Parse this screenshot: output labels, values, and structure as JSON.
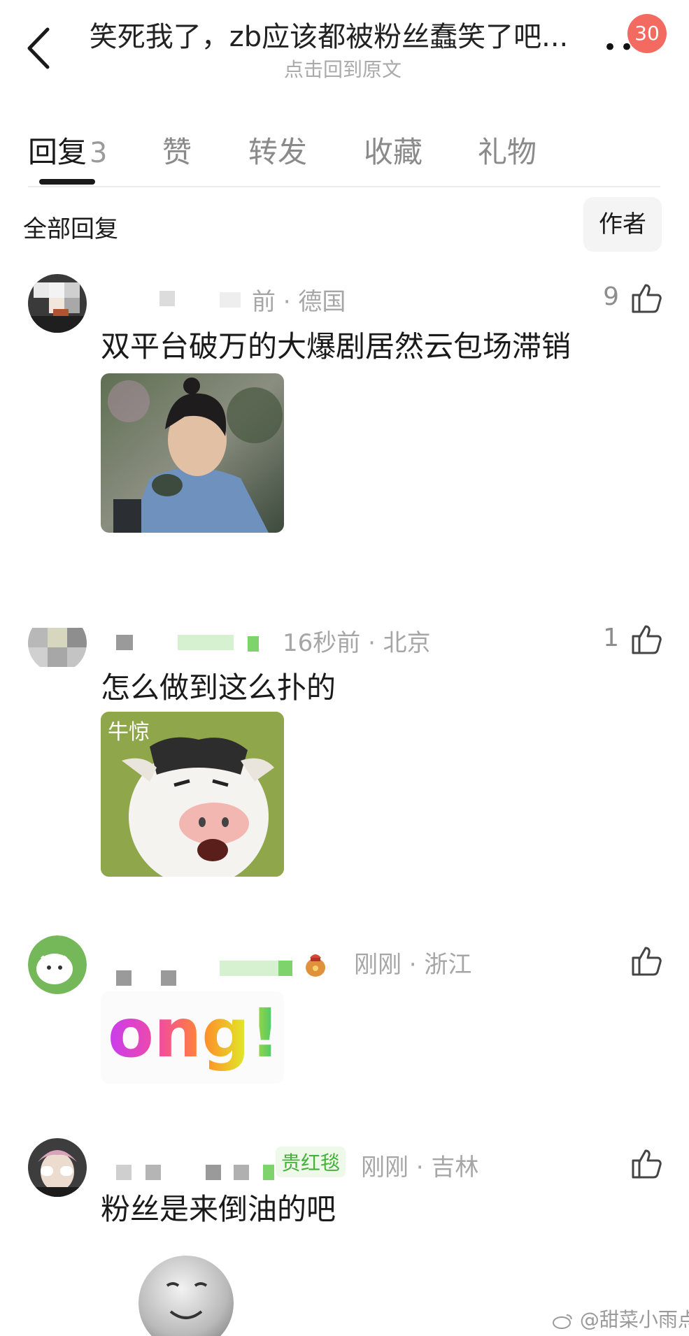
{
  "header": {
    "title": "笑死我了，zb应该都被粉丝蠢笑了吧...",
    "subtitle": "点击回到原文",
    "badge": "30",
    "more_label": "••"
  },
  "tabs": [
    {
      "label": "回复",
      "count": "3"
    },
    {
      "label": "赞"
    },
    {
      "label": "转发"
    },
    {
      "label": "收藏"
    },
    {
      "label": "礼物"
    }
  ],
  "filter": {
    "all_label": "全部回复",
    "author_label": "作者"
  },
  "comments": [
    {
      "meta": "前 · 德国",
      "likes": "9",
      "text": "双平台破万的大爆剧居然云包场滞销",
      "image": "man-drinking-tea"
    },
    {
      "meta": "16秒前 · 北京",
      "likes": "1",
      "text": "怎么做到这么扑的",
      "image_caption": "牛惊"
    },
    {
      "meta": "刚刚 · 浙江",
      "likes": "",
      "image_text": "ong!"
    },
    {
      "meta": "刚刚 · 吉林",
      "likes": "",
      "gift": "贵红毯",
      "text": "粉丝是来倒油的吧"
    }
  ],
  "watermark": "@甜菜小雨点",
  "colors": {
    "badge": "#f26a60",
    "gift_green": "#45b03a"
  }
}
